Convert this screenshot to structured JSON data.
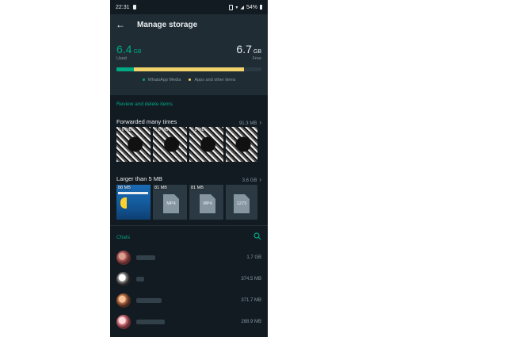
{
  "status_bar": {
    "time": "22:31",
    "battery": "54%"
  },
  "app_bar": {
    "title": "Manage storage"
  },
  "storage": {
    "used_value": "6.4",
    "used_unit": "GB",
    "used_label": "Used",
    "free_value": "6.7",
    "free_unit": "GB",
    "free_label": "Free",
    "whatsapp_fraction": 0.12,
    "apps_fraction": 0.76,
    "legend_whatsapp": "WhatsApp Media",
    "legend_apps": "Apps and other items",
    "colors": {
      "whatsapp": "#00a884",
      "apps": "#f1d36b",
      "free": "#2a3942"
    }
  },
  "review": {
    "title": "Review and delete items",
    "forwarded": {
      "label": "Forwarded many times",
      "size": "91.3 MB",
      "thumbs": [
        {
          "size": "6.6 MB"
        },
        {
          "size": "6.6 MB"
        },
        {
          "size": "6.5 MB"
        },
        {
          "size": ""
        }
      ]
    },
    "larger": {
      "label": "Larger than 5 MB",
      "size": "3.6 GB",
      "thumbs": [
        {
          "size": "88 MB",
          "type": "video-thumbnail"
        },
        {
          "size": "81 MB",
          "type": "file",
          "ext": "MP4"
        },
        {
          "size": "81 MB",
          "type": "file",
          "ext": "MP4"
        },
        {
          "size": "",
          "type": "file",
          "ext": "1273"
        }
      ]
    }
  },
  "chats": {
    "title": "Chats",
    "search_icon": "search-icon",
    "items": [
      {
        "size": "1.7 GB",
        "name_blur_width": 24
      },
      {
        "size": "374.5 MB",
        "name_blur_width": 10
      },
      {
        "size": "371.7 MB",
        "name_blur_width": 32
      },
      {
        "size": "288.9 MB",
        "name_blur_width": 36
      }
    ]
  }
}
